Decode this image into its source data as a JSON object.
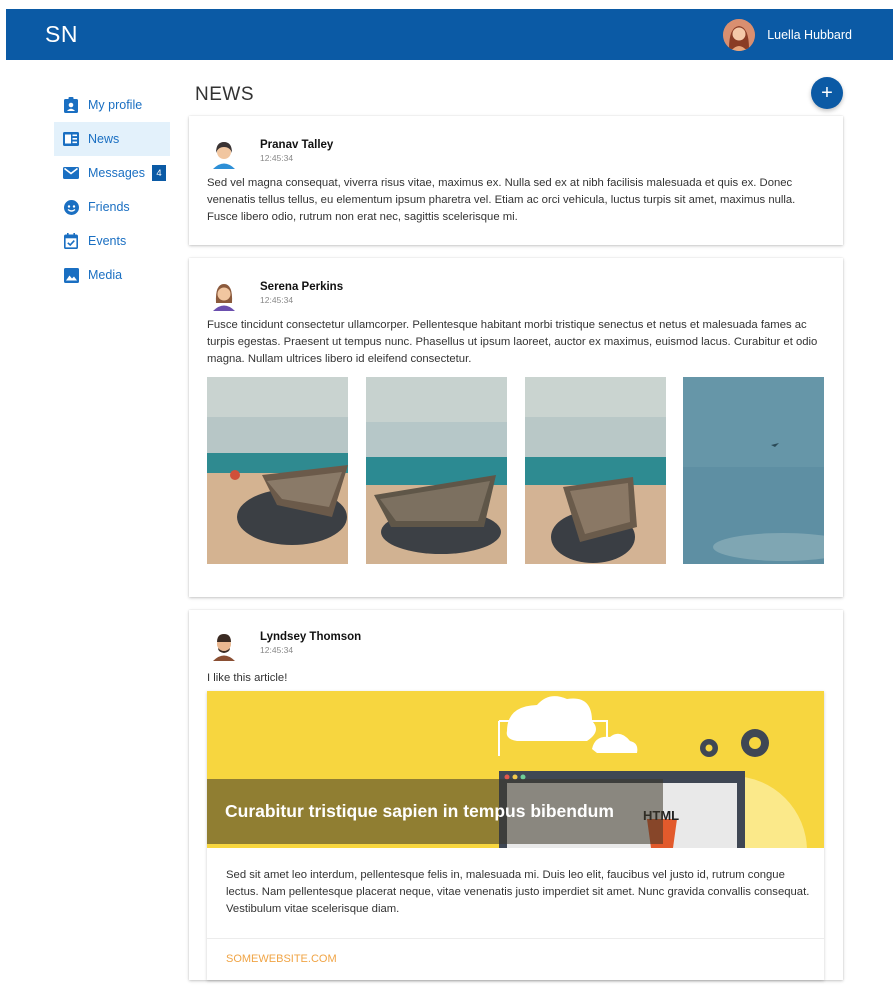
{
  "header": {
    "brand": "SN",
    "user_name": "Luella Hubbard",
    "avatar_icon": "user-avatar-icon",
    "bar_color": "#0b5aa5"
  },
  "sidebar": {
    "items": [
      {
        "label": "My profile",
        "icon": "profile-badge-icon"
      },
      {
        "label": "News",
        "icon": "newspaper-icon",
        "active": true
      },
      {
        "label": "Messages",
        "icon": "envelope-icon",
        "badge": "4"
      },
      {
        "label": "Friends",
        "icon": "smiley-icon"
      },
      {
        "label": "Events",
        "icon": "calendar-check-icon"
      },
      {
        "label": "Media",
        "icon": "image-icon"
      }
    ]
  },
  "main": {
    "title": "NEWS",
    "add_button": "+",
    "posts": [
      {
        "author": "Pranav Talley",
        "time": "12:45:34",
        "text": "Sed vel magna consequat, viverra risus vitae, maximus ex. Nulla sed ex at nibh facilisis malesuada et quis ex. Donec venenatis tellus tellus, eu elementum ipsum pharetra vel. Etiam ac orci vehicula, luctus turpis sit amet, maximus nulla. Fusce libero odio, rutrum non erat nec, sagittis scelerisque mi."
      },
      {
        "author": "Serena Perkins",
        "time": "12:45:34",
        "text": "Fusce tincidunt consectetur ullamcorper. Pellentesque habitant morbi tristique senectus et netus et malesuada fames ac turpis egestas. Praesent ut tempus nunc. Phasellus ut ipsum laoreet, auctor ex maximus, euismod lacus. Curabitur et odio magna. Nullam ultrices libero id eleifend consectetur.",
        "photos": [
          "beach-boat-photo",
          "beach-boat-photo",
          "beach-boat-photo",
          "sky-plane-photo"
        ]
      },
      {
        "author": "Lyndsey Thomson",
        "time": "12:45:34",
        "text": "I like this article!",
        "article": {
          "title": "Curabitur tristique sapien in tempus bibendum",
          "body": "Sed sit amet leo interdum, pellentesque felis in, malesuada mi. Duis leo elit, faucibus vel justo id, rutrum congue lectus. Nam pellentesque placerat neque, vitae venenatis justo imperdiet sit amet. Nunc gravida convallis consequat. Vestibulum vitae scelerisque diam.",
          "link": "SOMEWEBSITE.COM",
          "banner_label": "HTML"
        }
      }
    ]
  }
}
